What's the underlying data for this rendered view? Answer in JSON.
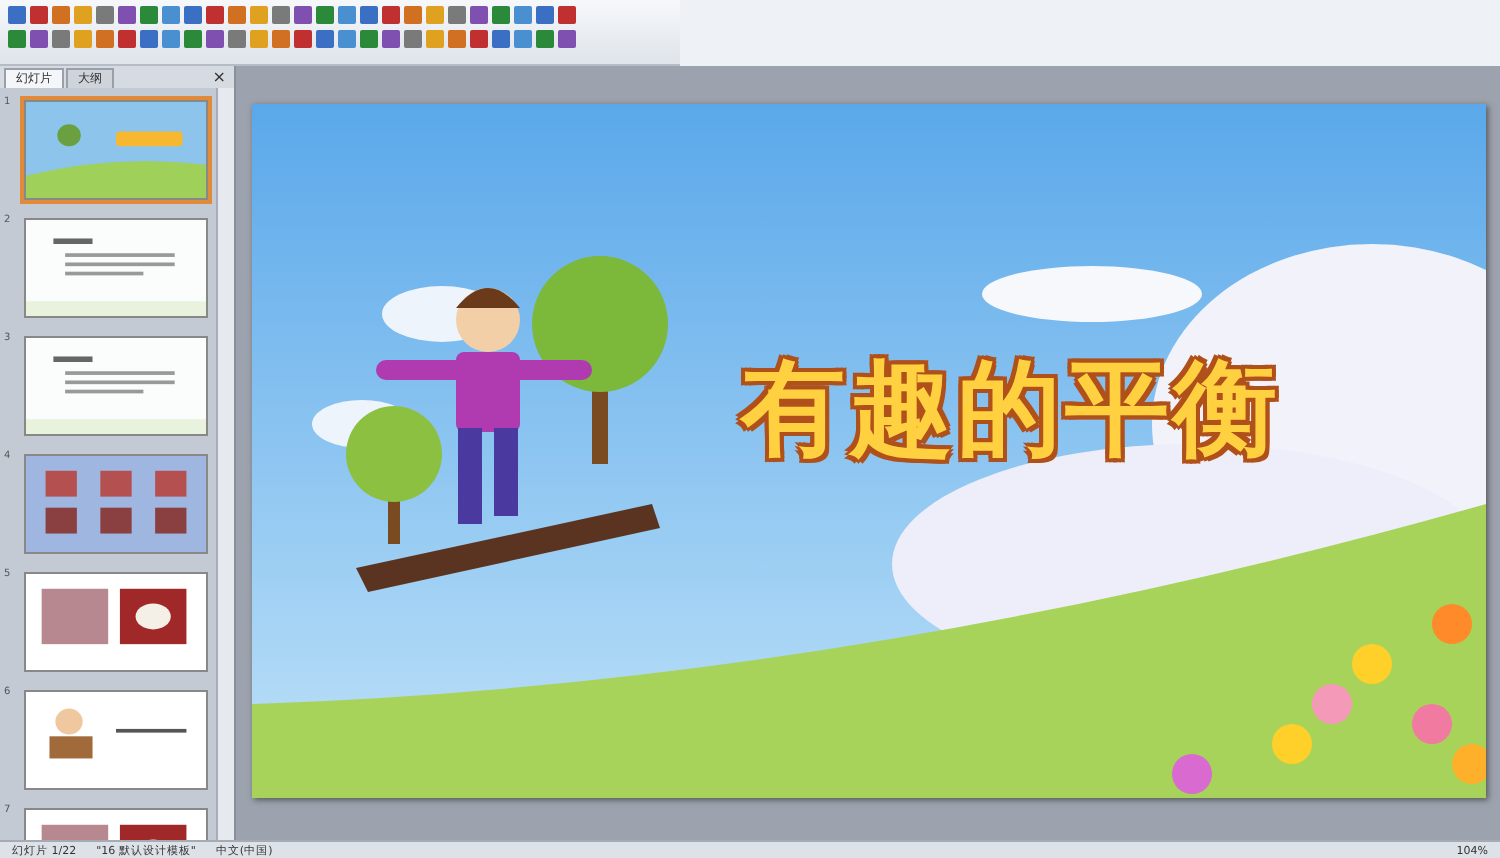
{
  "sidebar": {
    "tabs": [
      {
        "label": "幻灯片",
        "selected": true
      },
      {
        "label": "大纲",
        "selected": false
      }
    ],
    "close": "×",
    "slides": [
      {
        "number": "1",
        "selected": true,
        "kind": "title"
      },
      {
        "number": "2",
        "selected": false,
        "kind": "text"
      },
      {
        "number": "3",
        "selected": false,
        "kind": "text"
      },
      {
        "number": "4",
        "selected": false,
        "kind": "grid"
      },
      {
        "number": "5",
        "selected": false,
        "kind": "photos"
      },
      {
        "number": "6",
        "selected": false,
        "kind": "cartoon"
      },
      {
        "number": "7",
        "selected": false,
        "kind": "photos"
      }
    ]
  },
  "slide": {
    "title": "有趣的平衡"
  },
  "status_bar": {
    "slide_info": "幻灯片 1/22",
    "theme": "\"16 默认设计模板\"",
    "language": "中文(中国)",
    "zoom": "104%"
  }
}
